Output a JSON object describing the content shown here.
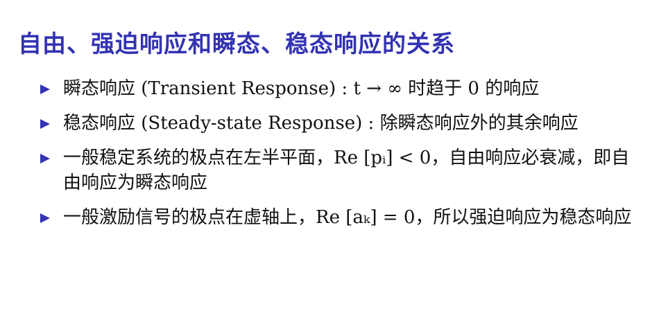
{
  "title": "自由、强迫响应和瞬态、稳态响应的关系",
  "colors": {
    "accent": "#3333b3",
    "text": "#111111",
    "background": "#ffffff"
  },
  "items": [
    {
      "text": "瞬态响应 (Transient Response) : t → ∞ 时趋于 0 的响应"
    },
    {
      "text": "稳态响应 (Steady-state Response) : 除瞬态响应外的其余响应"
    },
    {
      "text": "一般稳定系统的极点在左半平面，Re [pᵢ] < 0，自由响应必衰减，即自由响应为瞬态响应"
    },
    {
      "text": "一般激励信号的极点在虚轴上，Re [aₖ] = 0，所以强迫响应为稳态响应"
    }
  ]
}
